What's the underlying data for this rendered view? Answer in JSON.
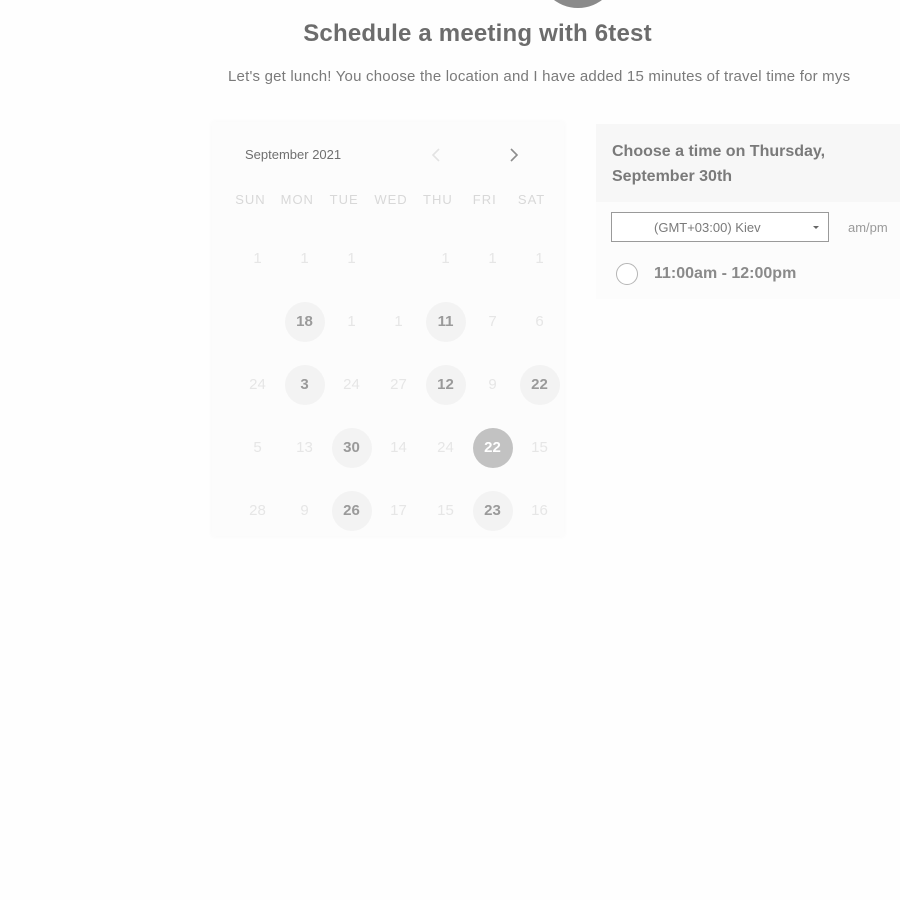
{
  "header": {
    "title": "Schedule a meeting with 6test",
    "description": "Let's get lunch! You choose the location and I have added 15 minutes of travel time for mys"
  },
  "calendar": {
    "month_label": "September 2021",
    "weekdays": [
      "SUN",
      "MON",
      "TUE",
      "WED",
      "THU",
      "FRI",
      "SAT"
    ],
    "weeks": [
      [
        {
          "label": "1",
          "state": "disabled"
        },
        {
          "label": "1",
          "state": "disabled"
        },
        {
          "label": "1",
          "state": "disabled"
        },
        {
          "label": "",
          "state": "disabled"
        },
        {
          "label": "1",
          "state": "disabled"
        },
        {
          "label": "1",
          "state": "disabled"
        },
        {
          "label": "1",
          "state": "disabled"
        }
      ],
      [
        {
          "label": "",
          "state": "disabled"
        },
        {
          "label": "18",
          "state": "available"
        },
        {
          "label": "1",
          "state": "disabled"
        },
        {
          "label": "1",
          "state": "disabled"
        },
        {
          "label": "11",
          "state": "available"
        },
        {
          "label": "7",
          "state": "disabled"
        },
        {
          "label": "6",
          "state": "disabled"
        }
      ],
      [
        {
          "label": "24",
          "state": "disabled"
        },
        {
          "label": "3",
          "state": "available"
        },
        {
          "label": "24",
          "state": "disabled"
        },
        {
          "label": "27",
          "state": "disabled"
        },
        {
          "label": "12",
          "state": "available"
        },
        {
          "label": "9",
          "state": "disabled"
        },
        {
          "label": "22",
          "state": "available"
        }
      ],
      [
        {
          "label": "5",
          "state": "disabled"
        },
        {
          "label": "13",
          "state": "disabled"
        },
        {
          "label": "30",
          "state": "available"
        },
        {
          "label": "14",
          "state": "disabled"
        },
        {
          "label": "24",
          "state": "disabled"
        },
        {
          "label": "22",
          "state": "selected"
        },
        {
          "label": "15",
          "state": "disabled"
        }
      ],
      [
        {
          "label": "28",
          "state": "disabled"
        },
        {
          "label": "9",
          "state": "disabled"
        },
        {
          "label": "26",
          "state": "available"
        },
        {
          "label": "17",
          "state": "disabled"
        },
        {
          "label": "15",
          "state": "disabled"
        },
        {
          "label": "23",
          "state": "available"
        },
        {
          "label": "16",
          "state": "disabled"
        }
      ]
    ]
  },
  "time_panel": {
    "heading": "Choose a time on Thursday, September 30th",
    "timezone_value": "(GMT+03:00) Kiev",
    "format_label": "am/pm",
    "slots": [
      "11:00am - 12:00pm"
    ]
  },
  "icons": {
    "prev": "chevron-left-icon",
    "next": "chevron-right-icon"
  }
}
